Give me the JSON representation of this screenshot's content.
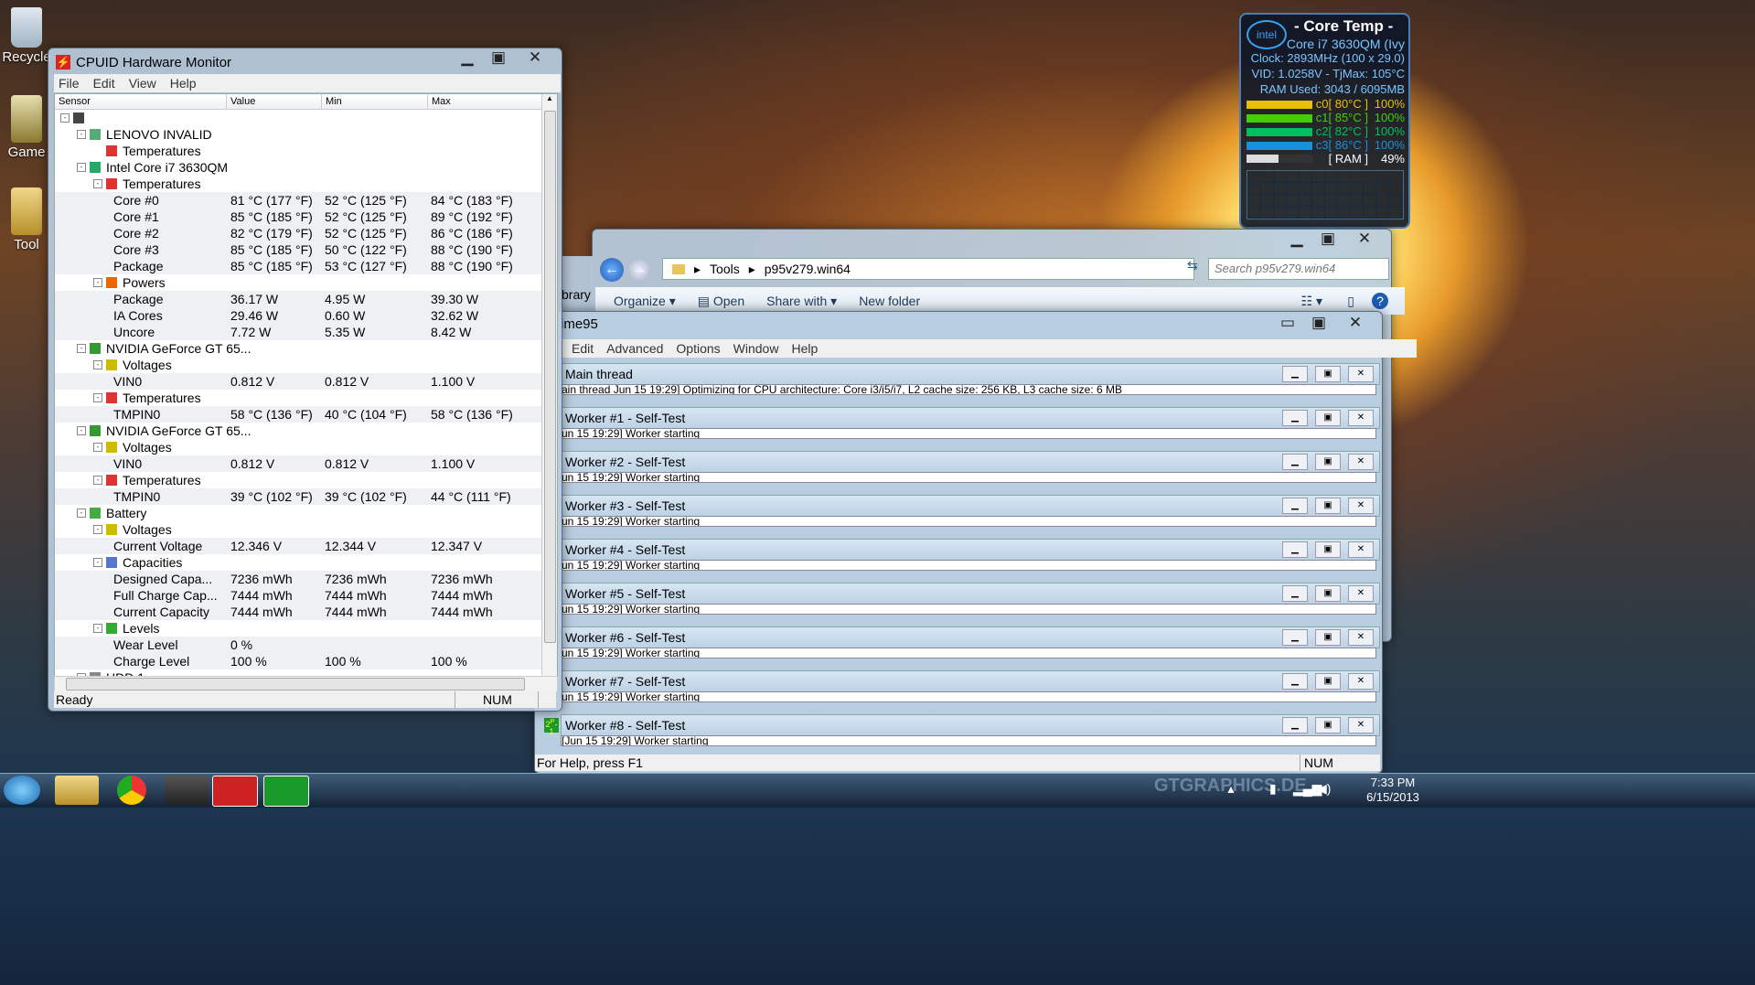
{
  "desktop_icons": [
    {
      "name": "recycle-bin-icon",
      "label": "Recycle"
    },
    {
      "name": "game-icon",
      "label": "Game"
    },
    {
      "name": "tools-icon",
      "label": "Tool"
    }
  ],
  "hwmonitor": {
    "title": "CPUID Hardware Monitor",
    "menu": [
      "File",
      "Edit",
      "View",
      "Help"
    ],
    "columns": [
      "Sensor",
      "Value",
      "Min",
      "Max"
    ],
    "status_left": "Ready",
    "status_num": "NUM",
    "rows": [
      {
        "indent": 0,
        "label": "",
        "toggle": "-",
        "icon": "computer-icon"
      },
      {
        "indent": 1,
        "label": "LENOVO INVALID",
        "toggle": "-",
        "icon": "motherboard-icon"
      },
      {
        "indent": 2,
        "label": "Temperatures",
        "icon": "thermometer-icon"
      },
      {
        "indent": 1,
        "label": "Intel Core i7 3630QM",
        "toggle": "-",
        "icon": "cpu-icon"
      },
      {
        "indent": 2,
        "label": "Temperatures",
        "toggle": "-",
        "icon": "thermometer-icon"
      },
      {
        "indent": 3,
        "label": "Core #0",
        "value": "81 °C  (177 °F)",
        "min": "52 °C  (125 °F)",
        "max": "84 °C  (183 °F)"
      },
      {
        "indent": 3,
        "label": "Core #1",
        "value": "85 °C  (185 °F)",
        "min": "52 °C  (125 °F)",
        "max": "89 °C  (192 °F)"
      },
      {
        "indent": 3,
        "label": "Core #2",
        "value": "82 °C  (179 °F)",
        "min": "52 °C  (125 °F)",
        "max": "86 °C  (186 °F)"
      },
      {
        "indent": 3,
        "label": "Core #3",
        "value": "85 °C  (185 °F)",
        "min": "50 °C  (122 °F)",
        "max": "88 °C  (190 °F)"
      },
      {
        "indent": 3,
        "label": "Package",
        "value": "85 °C  (185 °F)",
        "min": "53 °C  (127 °F)",
        "max": "88 °C  (190 °F)"
      },
      {
        "indent": 2,
        "label": "Powers",
        "toggle": "-",
        "icon": "power-icon"
      },
      {
        "indent": 3,
        "label": "Package",
        "value": "36.17 W",
        "min": "4.95 W",
        "max": "39.30 W"
      },
      {
        "indent": 3,
        "label": "IA Cores",
        "value": "29.46 W",
        "min": "0.60 W",
        "max": "32.62 W"
      },
      {
        "indent": 3,
        "label": "Uncore",
        "value": "7.72 W",
        "min": "5.35 W",
        "max": "8.42 W"
      },
      {
        "indent": 1,
        "label": "NVIDIA GeForce GT 65...",
        "toggle": "-",
        "icon": "gpu-icon"
      },
      {
        "indent": 2,
        "label": "Voltages",
        "toggle": "-",
        "icon": "voltage-icon"
      },
      {
        "indent": 3,
        "label": "VIN0",
        "value": "0.812 V",
        "min": "0.812 V",
        "max": "1.100 V"
      },
      {
        "indent": 2,
        "label": "Temperatures",
        "toggle": "-",
        "icon": "thermometer-icon"
      },
      {
        "indent": 3,
        "label": "TMPIN0",
        "value": "58 °C  (136 °F)",
        "min": "40 °C  (104 °F)",
        "max": "58 °C  (136 °F)"
      },
      {
        "indent": 1,
        "label": "NVIDIA GeForce GT 65...",
        "toggle": "-",
        "icon": "gpu-icon"
      },
      {
        "indent": 2,
        "label": "Voltages",
        "toggle": "-",
        "icon": "voltage-icon"
      },
      {
        "indent": 3,
        "label": "VIN0",
        "value": "0.812 V",
        "min": "0.812 V",
        "max": "1.100 V"
      },
      {
        "indent": 2,
        "label": "Temperatures",
        "toggle": "-",
        "icon": "thermometer-icon"
      },
      {
        "indent": 3,
        "label": "TMPIN0",
        "value": "39 °C  (102 °F)",
        "min": "39 °C  (102 °F)",
        "max": "44 °C  (111 °F)"
      },
      {
        "indent": 1,
        "label": "Battery",
        "toggle": "-",
        "icon": "battery-icon"
      },
      {
        "indent": 2,
        "label": "Voltages",
        "toggle": "-",
        "icon": "voltage-icon"
      },
      {
        "indent": 3,
        "label": "Current Voltage",
        "value": "12.346 V",
        "min": "12.344 V",
        "max": "12.347 V"
      },
      {
        "indent": 2,
        "label": "Capacities",
        "toggle": "-",
        "icon": "capacity-icon"
      },
      {
        "indent": 3,
        "label": "Designed Capa...",
        "value": "7236 mWh",
        "min": "7236 mWh",
        "max": "7236 mWh"
      },
      {
        "indent": 3,
        "label": "Full Charge Cap...",
        "value": "7444 mWh",
        "min": "7444 mWh",
        "max": "7444 mWh"
      },
      {
        "indent": 3,
        "label": "Current Capacity",
        "value": "7444 mWh",
        "min": "7444 mWh",
        "max": "7444 mWh"
      },
      {
        "indent": 2,
        "label": "Levels",
        "toggle": "-",
        "icon": "levels-icon"
      },
      {
        "indent": 3,
        "label": "Wear Level",
        "value": "0 %",
        "min": "",
        "max": ""
      },
      {
        "indent": 3,
        "label": "Charge Level",
        "value": "100 %",
        "min": "100 %",
        "max": "100 %"
      },
      {
        "indent": 1,
        "label": "HDD 1",
        "toggle": "-",
        "icon": "hdd-icon"
      }
    ]
  },
  "coretemp": {
    "title": "- Core Temp -",
    "brand": "intel",
    "cpu": "Core i7 3630QM (Ivy",
    "clock": "Clock: 2893MHz (100 x 29.0)",
    "vid": "VID: 1.0258V - TjMax: 105°C",
    "ram": "RAM Used: 3043 / 6095MB",
    "cores": [
      {
        "label": "c0[ 80°C ]",
        "load": "100%",
        "color": "#e8c000",
        "fill": 1.0
      },
      {
        "label": "c1[ 85°C ]",
        "load": "100%",
        "color": "#40d000",
        "fill": 1.0
      },
      {
        "label": "c2[ 82°C ]",
        "load": "100%",
        "color": "#00c060",
        "fill": 1.0
      },
      {
        "label": "c3[ 86°C ]",
        "load": "100%",
        "color": "#1890e0",
        "fill": 1.0
      }
    ],
    "ram_label": "[ RAM ]",
    "ram_pct": "49%",
    "ram_fill": 0.49
  },
  "explorer": {
    "breadcrumb": [
      "Tools",
      "p95v279.win64"
    ],
    "search_placeholder": "Search p95v279.win64",
    "commands": [
      "Organize",
      "Open",
      "Share with",
      "New folder"
    ],
    "left_pane_partial": "brary"
  },
  "prime95": {
    "title": "ime95",
    "menu": [
      "Edit",
      "Advanced",
      "Options",
      "Window",
      "Help"
    ],
    "windows": [
      {
        "title": "Main thread",
        "log": "ain thread  Jun 15 19:29] Optimizing for CPU architecture: Core i3/i5/i7, L2 cache size: 256 KB, L3 cache size: 6 MB"
      },
      {
        "title": "Worker #1 - Self-Test",
        "log": "un 15 19:29] Worker starting"
      },
      {
        "title": "Worker #2 - Self-Test",
        "log": "un 15 19:29] Worker starting"
      },
      {
        "title": "Worker #3 - Self-Test",
        "log": "un 15 19:29] Worker starting"
      },
      {
        "title": "Worker #4 - Self-Test",
        "log": "un 15 19:29] Worker starting"
      },
      {
        "title": "Worker #5 - Self-Test",
        "log": "un 15 19:29] Worker starting"
      },
      {
        "title": "Worker #6 - Self-Test",
        "log": "un 15 19:29] Worker starting"
      },
      {
        "title": "Worker #7 - Self-Test",
        "log": "un 15 19:29] Worker starting"
      },
      {
        "title": "Worker #8 - Self-Test",
        "log": "[Jun 15 19:29] Worker starting"
      }
    ],
    "status": "For Help, press F1",
    "status_num": "NUM"
  },
  "taskbar": {
    "apps": [
      "start-orb",
      "explorer",
      "chrome",
      "steam",
      "hwmonitor",
      "prime95"
    ],
    "time": "7:33 PM",
    "date": "6/15/2013",
    "watermark": "GTGRAPHICS.DE"
  }
}
